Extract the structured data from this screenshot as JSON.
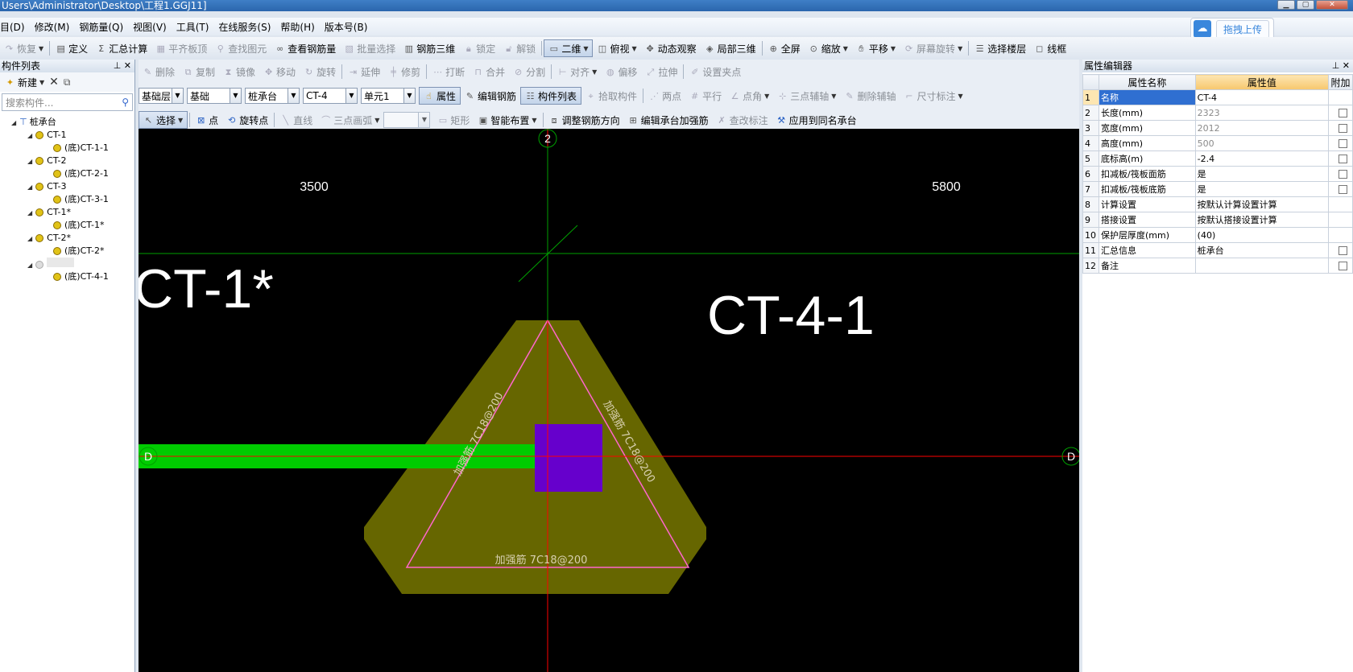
{
  "title": "Users\\Administrator\\Desktop\\工程1.GGJ11]",
  "menu": [
    "目(D)",
    "修改(M)",
    "钢筋量(Q)",
    "视图(V)",
    "工具(T)",
    "在线服务(S)",
    "帮助(H)",
    "版本号(B)"
  ],
  "upload_label": "拖拽上传",
  "toolbar1": {
    "redo": "恢复",
    "define": "定义",
    "summary": "汇总计算",
    "flat_board_top": "平齐板顶",
    "find_element": "查找图元",
    "view_rebar_qty": "查看钢筋量",
    "batch_select": "批量选择",
    "rebar_3d": "钢筋三维",
    "lock": "锁定",
    "unlock": "解锁",
    "view_2d": "二维",
    "top_view": "俯视",
    "dynamic_view": "动态观察",
    "local_3d": "局部三维",
    "fullscreen": "全屏",
    "zoom": "缩放",
    "pan": "平移",
    "screen_rotate": "屏幕旋转",
    "select_floor": "选择楼层",
    "wireframe": "线框"
  },
  "left_panel": {
    "title": "构件列表",
    "new_label": "新建",
    "search_placeholder": "搜索构件...",
    "tree_root": "桩承台",
    "tree": [
      {
        "name": "CT-1",
        "child": "(底)CT-1-1"
      },
      {
        "name": "CT-2",
        "child": "(底)CT-2-1"
      },
      {
        "name": "CT-3",
        "child": "(底)CT-3-1"
      },
      {
        "name": "CT-1*",
        "child": "(底)CT-1*"
      },
      {
        "name": "CT-2*",
        "child": "(底)CT-2*"
      },
      {
        "name": "",
        "child": "(底)CT-4-1"
      }
    ]
  },
  "cad_row1": {
    "delete": "删除",
    "copy": "复制",
    "mirror": "镜像",
    "move": "移动",
    "rotate": "旋转",
    "extend": "延伸",
    "trim": "修剪",
    "break": "打断",
    "merge": "合并",
    "split": "分割",
    "align": "对齐",
    "offset": "偏移",
    "stretch": "拉伸",
    "set_grip": "设置夹点"
  },
  "cad_row2": {
    "floor": "基础层",
    "category": "基础",
    "type": "桩承台",
    "element": "CT-4",
    "unit": "单元1",
    "properties": "属性",
    "edit_rebar": "编辑钢筋",
    "element_list": "构件列表",
    "pick_element": "拾取构件",
    "two_point": "两点",
    "parallel": "平行",
    "point_angle": "点角",
    "three_point_aux": "三点辅轴",
    "delete_aux": "删除辅轴",
    "dimension": "尺寸标注"
  },
  "cad_row3": {
    "select": "选择",
    "point": "点",
    "rotate_point": "旋转点",
    "line": "直线",
    "arc": "三点画弧",
    "rect": "矩形",
    "smart_place": "智能布置",
    "adjust_rebar_dir": "调整钢筋方向",
    "edit_cap_rebar": "编辑承台加强筋",
    "modify_label": "查改标注",
    "apply_same": "应用到同名承台"
  },
  "canvas": {
    "axis_top": "2",
    "axis_left": "D",
    "axis_right": "D",
    "dim_left": "3500",
    "dim_right": "5800",
    "label_left": "CT-1*",
    "label_main": "CT-4-1",
    "rebar_left": "加强筋 7C18@200",
    "rebar_right": "加强筋 7C18@200",
    "rebar_bottom": "加强筋 7C18@200"
  },
  "property_editor": {
    "title": "属性编辑器",
    "col_name": "属性名称",
    "col_value": "属性值",
    "col_extra": "附加",
    "rows": [
      {
        "no": "1",
        "name": "名称",
        "value": "CT-4",
        "grey": false,
        "checkbox": false
      },
      {
        "no": "2",
        "name": "长度(mm)",
        "value": "2323",
        "grey": true,
        "checkbox": true
      },
      {
        "no": "3",
        "name": "宽度(mm)",
        "value": "2012",
        "grey": true,
        "checkbox": true
      },
      {
        "no": "4",
        "name": "高度(mm)",
        "value": "500",
        "grey": true,
        "checkbox": true
      },
      {
        "no": "5",
        "name": "底标高(m)",
        "value": "-2.4",
        "grey": false,
        "checkbox": true
      },
      {
        "no": "6",
        "name": "扣减板/筏板面筋",
        "value": "是",
        "grey": false,
        "checkbox": true
      },
      {
        "no": "7",
        "name": "扣减板/筏板底筋",
        "value": "是",
        "grey": false,
        "checkbox": true
      },
      {
        "no": "8",
        "name": "计算设置",
        "value": "按默认计算设置计算",
        "grey": false,
        "checkbox": false
      },
      {
        "no": "9",
        "name": "搭接设置",
        "value": "按默认搭接设置计算",
        "grey": false,
        "checkbox": false
      },
      {
        "no": "10",
        "name": "保护层厚度(mm)",
        "value": "(40)",
        "grey": false,
        "checkbox": false
      },
      {
        "no": "11",
        "name": "汇总信息",
        "value": "桩承台",
        "grey": false,
        "checkbox": true
      },
      {
        "no": "12",
        "name": "备注",
        "value": "",
        "grey": false,
        "checkbox": true
      }
    ]
  },
  "colors": {
    "canvas_bg": "#000000",
    "cap_fill": "#666600",
    "column_fill": "#6600cc",
    "beam_fill": "#00cc00",
    "axis_red": "#ff0000",
    "axis_green": "#00a000",
    "rebar_pink": "#ff66cc",
    "selected_row": "#2f6fd1"
  }
}
